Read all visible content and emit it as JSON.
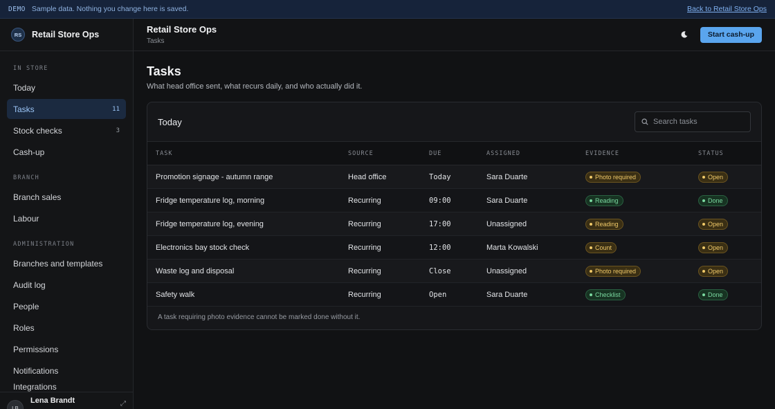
{
  "banner": {
    "tag": "DEMO",
    "text": "Sample data. Nothing you change here is saved.",
    "link": "Back to Retail Store Ops"
  },
  "brand": {
    "initials": "RS",
    "name": "Retail Store Ops"
  },
  "sidebar": {
    "sections": [
      {
        "title": "IN STORE",
        "items": [
          {
            "label": "Today",
            "count": ""
          },
          {
            "label": "Tasks",
            "count": "11",
            "active": true
          },
          {
            "label": "Stock checks",
            "count": "3"
          },
          {
            "label": "Cash-up",
            "count": ""
          }
        ]
      },
      {
        "title": "BRANCH",
        "items": [
          {
            "label": "Branch sales",
            "count": ""
          },
          {
            "label": "Labour",
            "count": ""
          }
        ]
      },
      {
        "title": "ADMINISTRATION",
        "items": [
          {
            "label": "Branches and templates",
            "count": ""
          },
          {
            "label": "Audit log",
            "count": ""
          },
          {
            "label": "People",
            "count": ""
          },
          {
            "label": "Roles",
            "count": ""
          },
          {
            "label": "Permissions",
            "count": ""
          },
          {
            "label": "Notifications",
            "count": ""
          },
          {
            "label": "Integrations",
            "count": ""
          }
        ]
      }
    ],
    "user": {
      "initials": "LB",
      "name": "Lena Brandt"
    }
  },
  "header": {
    "title": "Retail Store Ops",
    "subtitle": "Tasks",
    "theme_icon": "moon-icon",
    "primary_action": "Start cash-up"
  },
  "page": {
    "title": "Tasks",
    "subtitle": "What head office sent, what recurs daily, and who actually did it."
  },
  "card": {
    "title": "Today",
    "search_placeholder": "Search tasks",
    "columns": [
      "TASK",
      "SOURCE",
      "DUE",
      "ASSIGNED",
      "EVIDENCE",
      "STATUS"
    ],
    "rows": [
      {
        "task": "Promotion signage - autumn range",
        "source": "Head office",
        "due": "Today",
        "assigned": "Sara Duarte",
        "evidence": "Photo required",
        "evidence_tone": "amber",
        "status": "Open",
        "status_tone": "amber"
      },
      {
        "task": "Fridge temperature log, morning",
        "source": "Recurring",
        "due": "09:00",
        "assigned": "Sara Duarte",
        "evidence": "Reading",
        "evidence_tone": "green",
        "status": "Done",
        "status_tone": "green"
      },
      {
        "task": "Fridge temperature log, evening",
        "source": "Recurring",
        "due": "17:00",
        "assigned": "Unassigned",
        "evidence": "Reading",
        "evidence_tone": "amber",
        "status": "Open",
        "status_tone": "amber"
      },
      {
        "task": "Electronics bay stock check",
        "source": "Recurring",
        "due": "12:00",
        "assigned": "Marta Kowalski",
        "evidence": "Count",
        "evidence_tone": "amber",
        "status": "Open",
        "status_tone": "amber"
      },
      {
        "task": "Waste log and disposal",
        "source": "Recurring",
        "due": "Close",
        "assigned": "Unassigned",
        "evidence": "Photo required",
        "evidence_tone": "amber",
        "status": "Open",
        "status_tone": "amber"
      },
      {
        "task": "Safety walk",
        "source": "Recurring",
        "due": "Open",
        "assigned": "Sara Duarte",
        "evidence": "Checklist",
        "evidence_tone": "green",
        "status": "Done",
        "status_tone": "green"
      }
    ],
    "footnote": "A task requiring photo evidence cannot be marked done without it."
  },
  "colors": {
    "accent": "#5aa5ee",
    "amber": "#f0c968",
    "green": "#7ad9a0",
    "background": "#111214"
  }
}
